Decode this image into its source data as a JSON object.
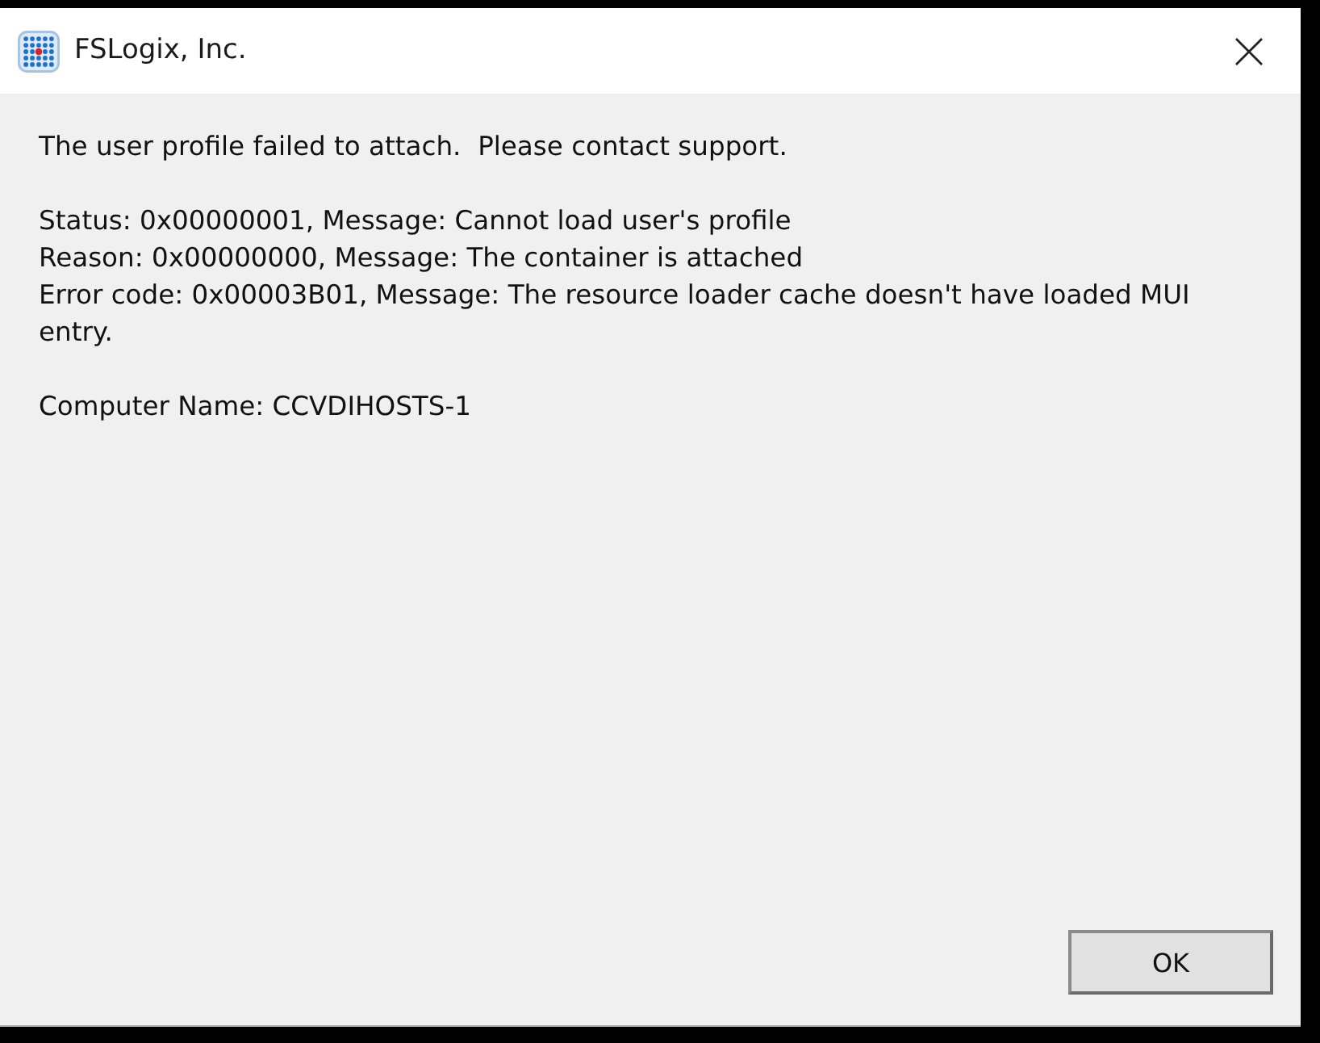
{
  "window": {
    "title": "FSLogix, Inc."
  },
  "message": {
    "summary": "The user profile failed to attach.  Please contact support.",
    "details": [
      "Status: 0x00000001, Message: Cannot load user's profile",
      "Reason: 0x00000000, Message: The container is attached",
      "Error code: 0x00003B01, Message: The resource loader cache doesn't have loaded MUI entry."
    ],
    "computer_name": "Computer Name: CCVDIHOSTS-1"
  },
  "buttons": [
    {
      "label": "OK"
    }
  ]
}
